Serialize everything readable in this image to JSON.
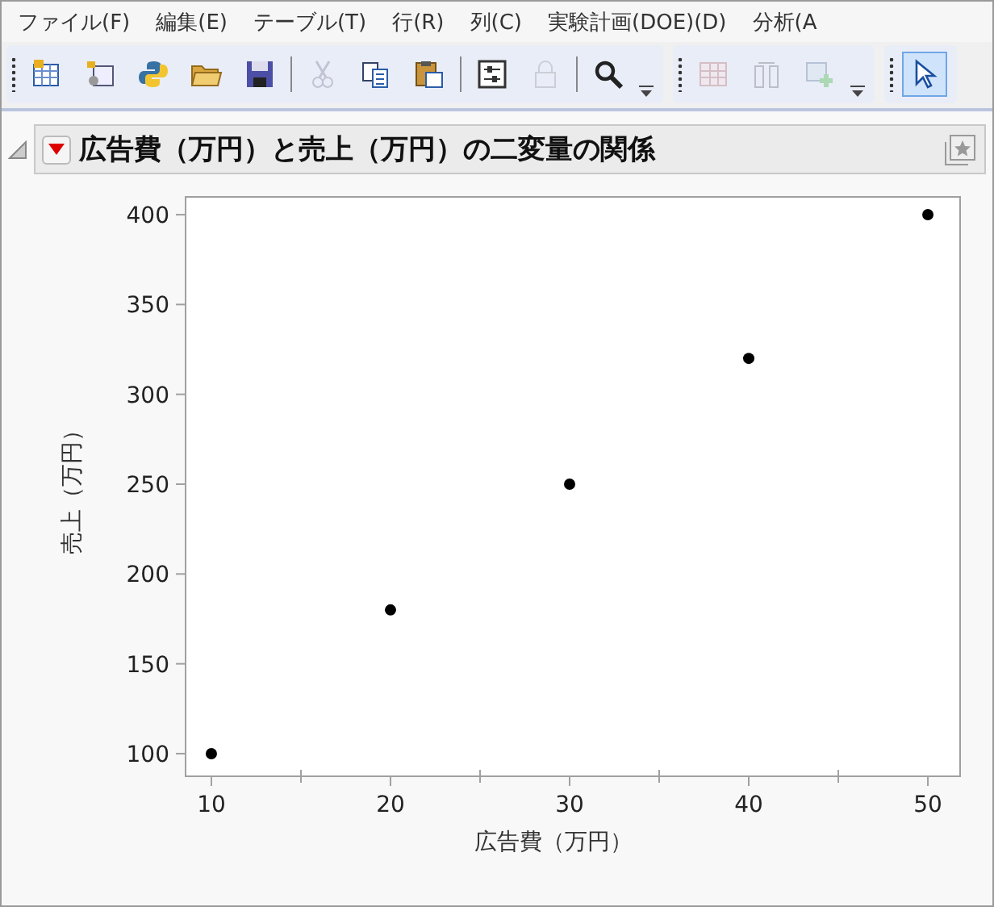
{
  "menu": [
    {
      "label": "ファイル(F)"
    },
    {
      "label": "編集(E)"
    },
    {
      "label": "テーブル(T)"
    },
    {
      "label": "行(R)"
    },
    {
      "label": "列(C)"
    },
    {
      "label": "実験計画(DOE)(D)"
    },
    {
      "label": "分析(A"
    }
  ],
  "toolbars": [
    {
      "buttons": [
        {
          "kind": "new-table",
          "disabled": false,
          "selected": false
        },
        {
          "kind": "open-data",
          "disabled": false,
          "selected": false
        },
        {
          "kind": "python",
          "disabled": false,
          "selected": false
        },
        {
          "kind": "folder",
          "disabled": false,
          "selected": false
        },
        {
          "kind": "save",
          "disabled": false,
          "selected": false
        },
        {
          "kind": "separator"
        },
        {
          "kind": "cut",
          "disabled": true,
          "selected": false
        },
        {
          "kind": "copy",
          "disabled": false,
          "selected": false
        },
        {
          "kind": "paste",
          "disabled": false,
          "selected": false
        },
        {
          "kind": "separator"
        },
        {
          "kind": "sliders",
          "disabled": false,
          "selected": false
        },
        {
          "kind": "lock",
          "disabled": true,
          "selected": false
        },
        {
          "kind": "separator"
        },
        {
          "kind": "search",
          "disabled": false,
          "selected": false
        },
        {
          "kind": "overflow"
        }
      ]
    },
    {
      "buttons": [
        {
          "kind": "grid",
          "disabled": true,
          "selected": false
        },
        {
          "kind": "columns",
          "disabled": true,
          "selected": false
        },
        {
          "kind": "add-table",
          "disabled": true,
          "selected": false
        },
        {
          "kind": "overflow"
        }
      ]
    },
    {
      "buttons": [
        {
          "kind": "pointer",
          "disabled": false,
          "selected": true
        }
      ]
    }
  ],
  "report": {
    "title": "広告費（万円）と売上（万円）の二変量の関係",
    "expanded": true,
    "chart_data": {
      "type": "scatter",
      "xlabel": "広告費（万円）",
      "ylabel": "売上（万円）",
      "x": [
        10,
        20,
        30,
        40,
        50
      ],
      "series": [
        {
          "color": "#000000",
          "values": [
            100,
            180,
            250,
            320,
            400
          ]
        }
      ],
      "xlim": [
        8.56,
        51.8
      ],
      "ylim": [
        87.4,
        409.9
      ],
      "xticks": [
        10,
        20,
        30,
        40,
        50
      ],
      "yticks": [
        100,
        150,
        200,
        250,
        300,
        350,
        400
      ]
    }
  }
}
